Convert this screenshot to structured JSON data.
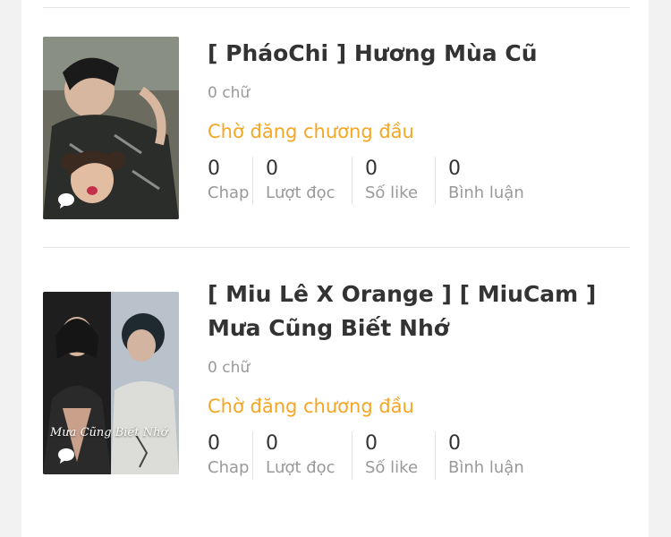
{
  "stories": [
    {
      "title": "[ PháoChi ] Hương Mùa Cũ",
      "words": "0 chữ",
      "status": "Chờ đăng chương đầu",
      "cover_caption": "",
      "stats": [
        {
          "value": "0",
          "label": "Chap"
        },
        {
          "value": "0",
          "label": "Lượt đọc"
        },
        {
          "value": "0",
          "label": "Số like"
        },
        {
          "value": "0",
          "label": "Bình luận"
        }
      ]
    },
    {
      "title": "[ Miu Lê X Orange ] [ MiuCam ] Mưa Cũng Biết Nhớ",
      "words": "0 chữ",
      "status": "Chờ đăng chương đầu",
      "cover_caption": "Mưa Cũng Biết Nhớ",
      "stats": [
        {
          "value": "0",
          "label": "Chap"
        },
        {
          "value": "0",
          "label": "Lượt đọc"
        },
        {
          "value": "0",
          "label": "Số like"
        },
        {
          "value": "0",
          "label": "Bình luận"
        }
      ]
    }
  ],
  "colors": {
    "status": "#f5a623",
    "page_bg": "#f2f2f2",
    "card_bg": "#ffffff"
  }
}
